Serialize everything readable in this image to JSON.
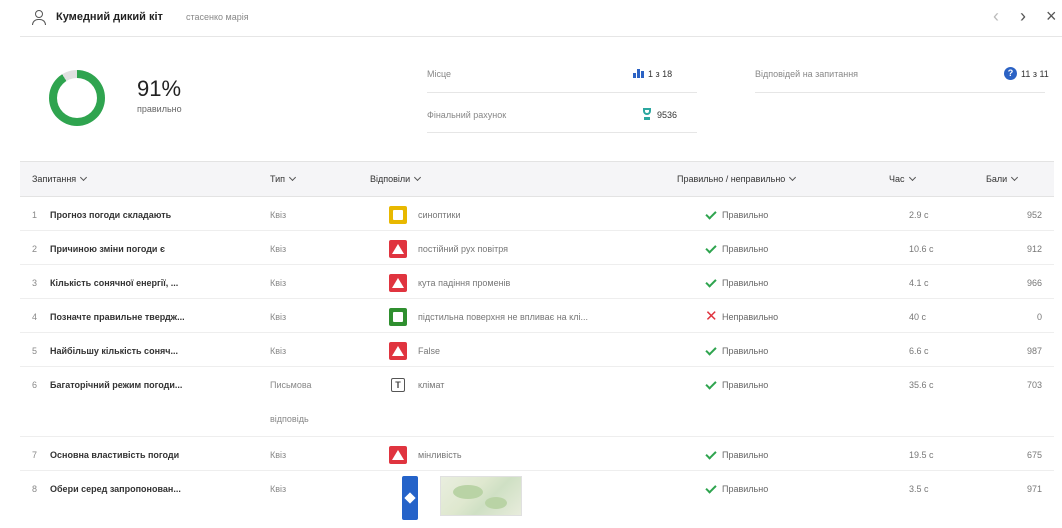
{
  "header": {
    "player_name": "Кумедний дикий кіт",
    "player_sub": "стасенко марія",
    "nav_prev": "‹",
    "nav_next": "›",
    "nav_close": "×"
  },
  "summary": {
    "percent": "91%",
    "percent_value": 91,
    "percent_label": "правильно",
    "place_label": "Місце",
    "place_value": "1 з 18",
    "answered_label": "Відповідей на запитання",
    "answered_value": "11 з 11",
    "final_score_label": "Фінальний рахунок",
    "final_score_value": "9536",
    "ring_color": "#2fa44f",
    "ring_track_color": "#e0e0e0"
  },
  "table": {
    "headers": {
      "question": "Запитання",
      "type": "Тип",
      "answers": "Відповіли",
      "correctness": "Правильно / неправильно",
      "time": "Час",
      "points": "Бали"
    },
    "rows": [
      {
        "num": "1",
        "question": "Прогноз погоди складають",
        "type": "Квіз",
        "type2": "",
        "answer_icon": "yellow-square",
        "answer": "синоптики",
        "result": "Правильно",
        "correct": true,
        "time": "2.9 с",
        "points": "952"
      },
      {
        "num": "2",
        "question": "Причиною зміни погоди є",
        "type": "Квіз",
        "type2": "",
        "answer_icon": "red-triangle",
        "answer": "постійний рух повітря",
        "result": "Правильно",
        "correct": true,
        "time": "10.6 с",
        "points": "912"
      },
      {
        "num": "3",
        "question": "Кількість сонячної енергії, ...",
        "type": "Квіз",
        "type2": "",
        "answer_icon": "red-triangle",
        "answer": "кута падіння променів",
        "result": "Правильно",
        "correct": true,
        "time": "4.1 с",
        "points": "966"
      },
      {
        "num": "4",
        "question": "Позначте правильне твердж...",
        "type": "Квіз",
        "type2": "",
        "answer_icon": "green-square",
        "answer": "підстильна поверхня не впливає на клі...",
        "result": "Неправильно",
        "correct": false,
        "time": "40 с",
        "points": "0"
      },
      {
        "num": "5",
        "question": "Найбільшу кількість соняч...",
        "type": "Квіз",
        "type2": "",
        "answer_icon": "red-triangle",
        "answer": "False",
        "result": "Правильно",
        "correct": true,
        "time": "6.6 с",
        "points": "987"
      },
      {
        "num": "6",
        "question": "Багаторічний режим погоди...",
        "type": "Письмова",
        "type2": "відповідь",
        "answer_icon": "text-box",
        "answer": "клімат",
        "result": "Правильно",
        "correct": true,
        "time": "35.6 с",
        "points": "703"
      },
      {
        "num": "7",
        "question": "Основна властивість погоди",
        "type": "Квіз",
        "type2": "",
        "answer_icon": "red-triangle",
        "answer": "мінливість",
        "result": "Правильно",
        "correct": true,
        "time": "19.5 с",
        "points": "675"
      },
      {
        "num": "8",
        "question": "Обери серед запропонован...",
        "type": "Квіз",
        "type2": "",
        "answer_icon": "blue-diamond-map",
        "answer": "",
        "result": "Правильно",
        "correct": true,
        "time": "3.5 с",
        "points": "971"
      }
    ]
  },
  "icons": {
    "user": "user-icon",
    "place": "bar-chart-icon",
    "score": "trophy-icon",
    "answered": "question-icon",
    "correct": "check-icon",
    "incorrect": "cross-icon",
    "sort": "chevron-down-icon"
  },
  "colors": {
    "correct": "#2fa44f",
    "incorrect": "#e0343f",
    "yellow": "#e8b800",
    "green": "#2f8f2f",
    "red": "#e0343f",
    "blue": "#2563c9"
  }
}
